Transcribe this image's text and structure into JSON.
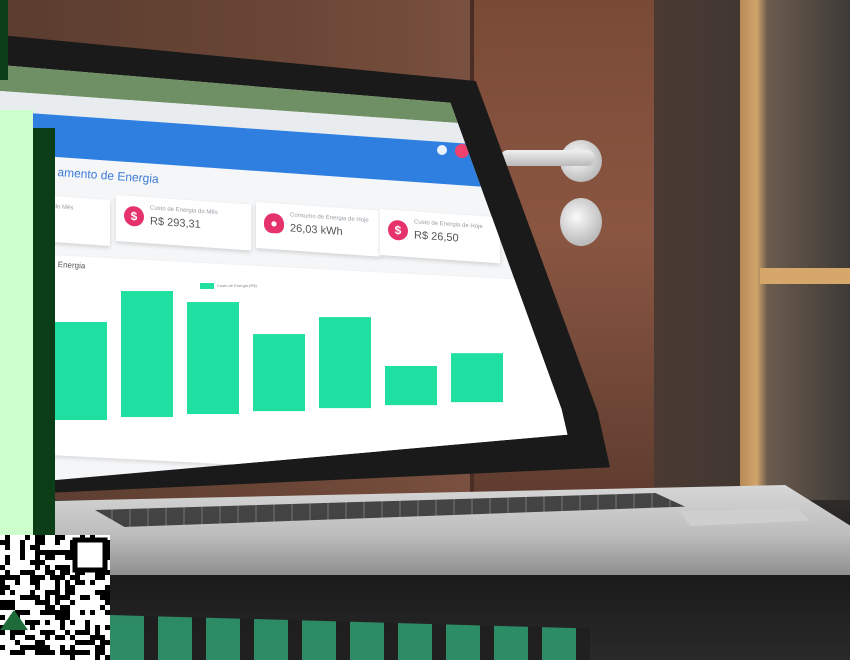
{
  "screen": {
    "page_title": "amento de Energia",
    "cards": [
      {
        "label": "gia do Mês",
        "value": ""
      },
      {
        "label": "Custo de Energia do Mês",
        "value": "R$ 293,31",
        "icon": "dollar-icon"
      },
      {
        "label": "Consumo de Energia de Hoje",
        "value": "26,03 kWh",
        "icon": "lightbulb-icon"
      },
      {
        "label": "Custo de Energia de Hoje",
        "value": "R$ 26,50",
        "icon": "dollar-icon"
      }
    ],
    "chart_title": "Energia",
    "legend_label": "Custo de Energia (R$)",
    "colors": {
      "bar": "#1fe0a0",
      "app_bar": "#2f7fe0",
      "accent": "#e5326b"
    }
  },
  "chart_data": {
    "type": "bar",
    "categories": [
      "",
      "",
      "",
      "",
      "",
      "",
      ""
    ],
    "series": [
      {
        "name": "Custo de Energia (R$)",
        "values": [
          70,
          90,
          80,
          55,
          65,
          28,
          35
        ]
      }
    ]
  }
}
